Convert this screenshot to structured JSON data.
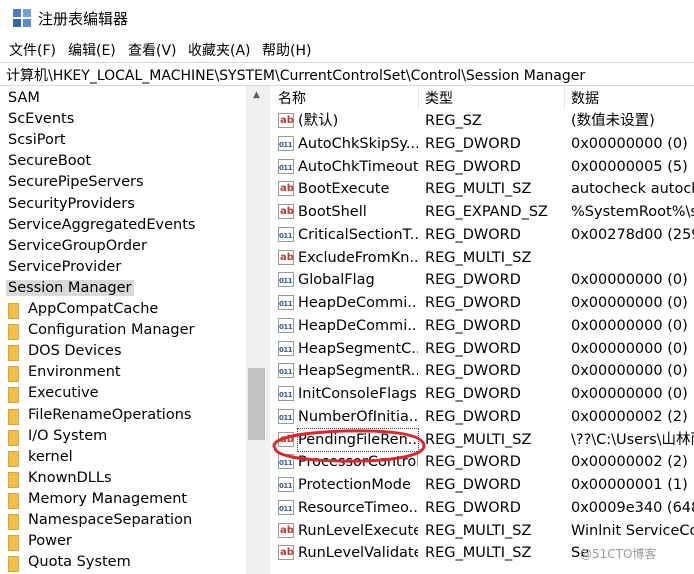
{
  "window": {
    "title": "注册表编辑器"
  },
  "menu": [
    {
      "label": "文件(F)"
    },
    {
      "label": "编辑(E)"
    },
    {
      "label": "查看(V)"
    },
    {
      "label": "收藏夹(A)"
    },
    {
      "label": "帮助(H)"
    }
  ],
  "address": "计算机\\HKEY_LOCAL_MACHINE\\SYSTEM\\CurrentControlSet\\Control\\Session Manager",
  "tree": {
    "parents": [
      {
        "label": "SAM"
      },
      {
        "label": "ScEvents"
      },
      {
        "label": "ScsiPort"
      },
      {
        "label": "SecureBoot"
      },
      {
        "label": "SecurePipeServers"
      },
      {
        "label": "SecurityProviders"
      },
      {
        "label": "ServiceAggregatedEvents"
      },
      {
        "label": "ServiceGroupOrder"
      },
      {
        "label": "ServiceProvider"
      },
      {
        "label": "Session Manager"
      }
    ],
    "children": [
      {
        "label": "AppCompatCache"
      },
      {
        "label": "Configuration Manager"
      },
      {
        "label": "DOS Devices"
      },
      {
        "label": "Environment"
      },
      {
        "label": "Executive"
      },
      {
        "label": "FileRenameOperations"
      },
      {
        "label": "I/O System"
      },
      {
        "label": "kernel"
      },
      {
        "label": "KnownDLLs"
      },
      {
        "label": "Memory Management"
      },
      {
        "label": "NamespaceSeparation"
      },
      {
        "label": "Power"
      },
      {
        "label": "Quota System"
      }
    ]
  },
  "columns": {
    "name": "名称",
    "type": "类型",
    "data": "数据"
  },
  "values": [
    {
      "icon": "string-value-icon",
      "name": "(默认)",
      "type": "REG_SZ",
      "data": "(数值未设置)"
    },
    {
      "icon": "binary-value-icon",
      "name": "AutoChkSkipSy...",
      "type": "REG_DWORD",
      "data": "0x00000000 (0)"
    },
    {
      "icon": "binary-value-icon",
      "name": "AutoChkTimeout",
      "type": "REG_DWORD",
      "data": "0x00000005 (5)"
    },
    {
      "icon": "string-value-icon",
      "name": "BootExecute",
      "type": "REG_MULTI_SZ",
      "data": "autocheck autoch"
    },
    {
      "icon": "string-value-icon",
      "name": "BootShell",
      "type": "REG_EXPAND_SZ",
      "data": "%SystemRoot%\\sy"
    },
    {
      "icon": "binary-value-icon",
      "name": "CriticalSectionT...",
      "type": "REG_DWORD",
      "data": "0x00278d00 (259"
    },
    {
      "icon": "string-value-icon",
      "name": "ExcludeFromKn...",
      "type": "REG_MULTI_SZ",
      "data": ""
    },
    {
      "icon": "binary-value-icon",
      "name": "GlobalFlag",
      "type": "REG_DWORD",
      "data": "0x00000000 (0)"
    },
    {
      "icon": "binary-value-icon",
      "name": "HeapDeCommi...",
      "type": "REG_DWORD",
      "data": "0x00000000 (0)"
    },
    {
      "icon": "binary-value-icon",
      "name": "HeapDeCommi...",
      "type": "REG_DWORD",
      "data": "0x00000000 (0)"
    },
    {
      "icon": "binary-value-icon",
      "name": "HeapSegmentC...",
      "type": "REG_DWORD",
      "data": "0x00000000 (0)"
    },
    {
      "icon": "binary-value-icon",
      "name": "HeapSegmentR...",
      "type": "REG_DWORD",
      "data": "0x00000000 (0)"
    },
    {
      "icon": "binary-value-icon",
      "name": "InitConsoleFlags",
      "type": "REG_DWORD",
      "data": "0x00000000 (0)"
    },
    {
      "icon": "binary-value-icon",
      "name": "NumberOfInitia...",
      "type": "REG_DWORD",
      "data": "0x00000002 (2)"
    },
    {
      "icon": "string-value-icon",
      "name": "PendingFileRen...",
      "type": "REG_MULTI_SZ",
      "data": "\\??\\C:\\Users\\山林雨"
    },
    {
      "icon": "binary-value-icon",
      "name": "ProcessorControl",
      "type": "REG_DWORD",
      "data": "0x00000002 (2)"
    },
    {
      "icon": "binary-value-icon",
      "name": "ProtectionMode",
      "type": "REG_DWORD",
      "data": "0x00000001 (1)"
    },
    {
      "icon": "binary-value-icon",
      "name": "ResourceTimeo...",
      "type": "REG_DWORD",
      "data": "0x0009e340 (648"
    },
    {
      "icon": "string-value-icon",
      "name": "RunLevelExecute",
      "type": "REG_MULTI_SZ",
      "data": "Winlnit ServiceCo"
    },
    {
      "icon": "string-value-icon",
      "name": "RunLevelValidate",
      "type": "REG_MULTI_SZ",
      "data": "Se"
    }
  ],
  "watermark": "@51CTO博客",
  "colors": {
    "annotation": "#e0242a",
    "selected": "#d9d9d9"
  }
}
